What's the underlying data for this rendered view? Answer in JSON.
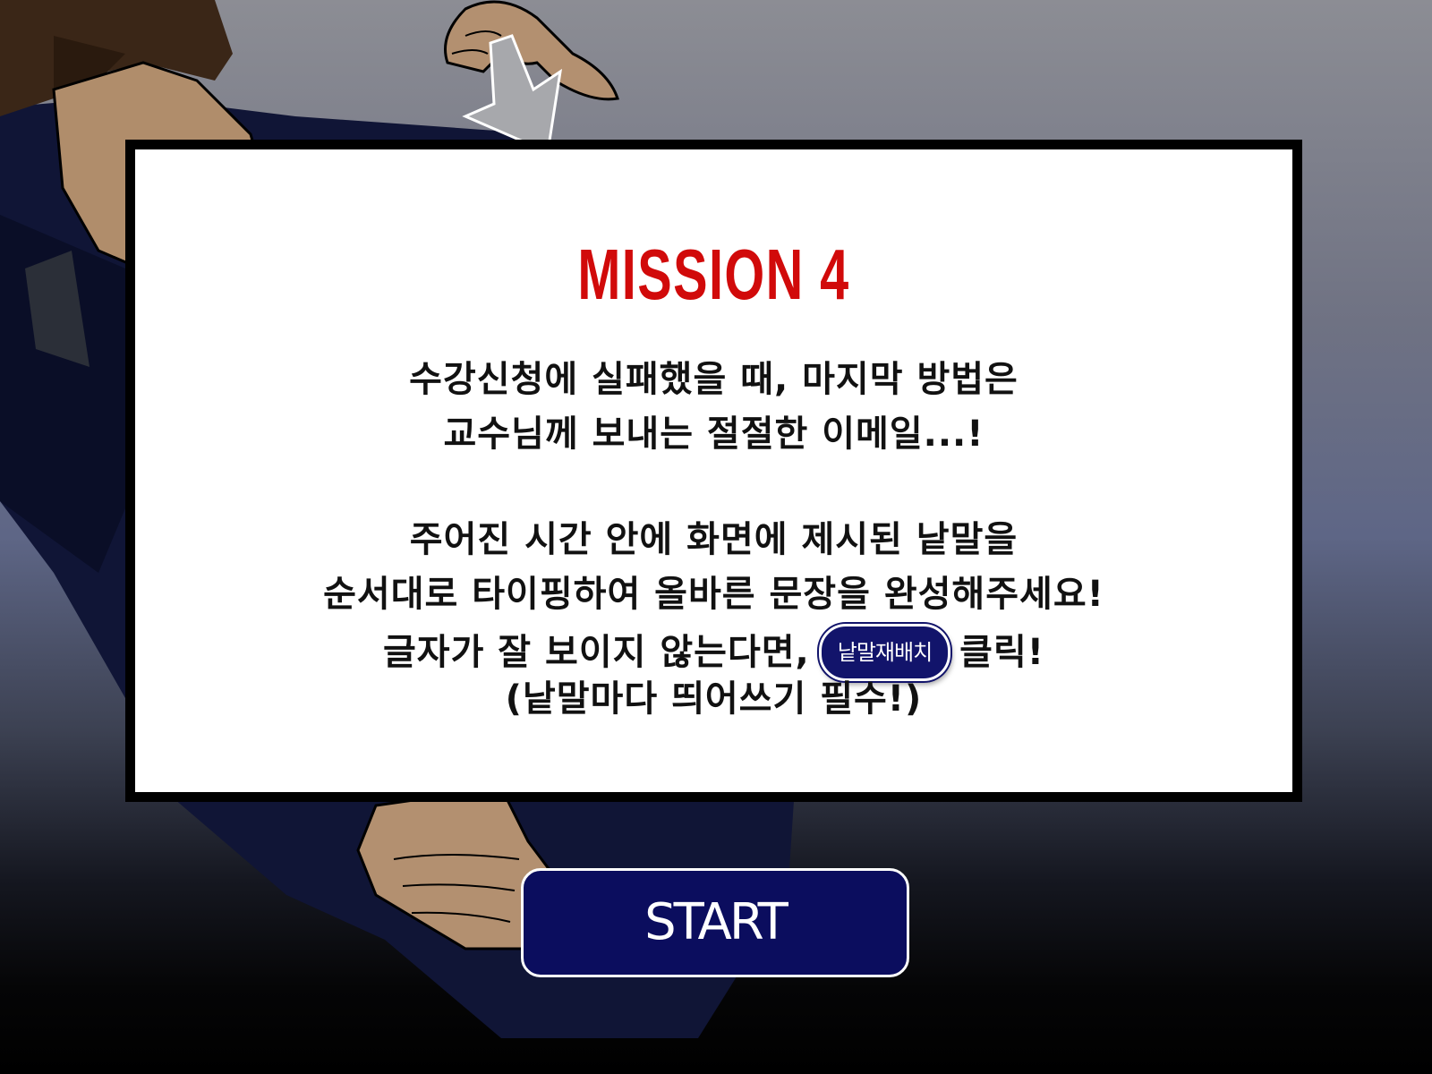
{
  "mission": {
    "title": "MISSION 4"
  },
  "message": {
    "line1": "수강신청에 실패했을 때, 마지막 방법은",
    "line2": "교수님께 보내는 절절한 이메일...!",
    "line3": "주어진 시간 안에 화면에 제시된 낱말을",
    "line4": "순서대로 타이핑하여 올바른 문장을 완성해주세요!",
    "line5_prefix": "글자가 잘 보이지 않는다면,",
    "line5_suffix": "클릭!",
    "line6": "(낱말마다 띄어쓰기 필수!)"
  },
  "buttons": {
    "shuffle_label": "낱말재배치",
    "start_label": "START"
  },
  "colors": {
    "title_red": "#d10a0a",
    "button_navy": "#0b0d5e",
    "dialog_border": "#000000"
  },
  "icons": {
    "pointer": "pointer-arrow-icon"
  }
}
